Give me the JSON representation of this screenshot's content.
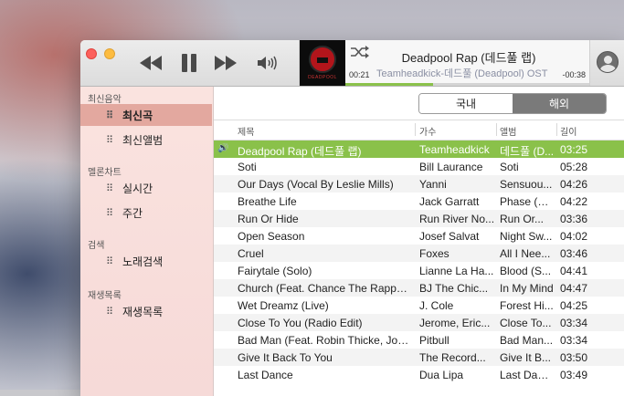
{
  "player": {
    "song_title": "Deadpool Rap (데드풀 랩)",
    "song_sub": "Teamheadkick-데드풀 (Deadpool) OST",
    "time_elapsed": "00:21",
    "time_remaining": "-00:38",
    "progress_fraction": 0.36,
    "album_art_caption": "DEADPOOL"
  },
  "sidebar": {
    "sections": [
      {
        "title": "최신음악",
        "items": [
          {
            "label": "최신곡",
            "active": true
          },
          {
            "label": "최신앨범",
            "active": false
          }
        ]
      },
      {
        "title": "멜론차트",
        "items": [
          {
            "label": "실시간",
            "active": false
          },
          {
            "label": "주간",
            "active": false
          }
        ]
      },
      {
        "title": "검색",
        "items": [
          {
            "label": "노래검색",
            "active": false
          }
        ]
      },
      {
        "title": "재생목록",
        "items": [
          {
            "label": "재생목록",
            "active": false
          }
        ]
      }
    ]
  },
  "segment": {
    "domestic": "국내",
    "foreign": "해외",
    "selected": "foreign"
  },
  "table": {
    "headers": {
      "title": "제목",
      "artist": "가수",
      "album": "앨범",
      "length": "길이"
    },
    "rows": [
      {
        "title": "Deadpool Rap (데드풀 랩)",
        "artist": "Teamheadkick",
        "album": "데드풀 (D...",
        "length": "03:25",
        "playing": true
      },
      {
        "title": "Soti",
        "artist": "Bill Laurance",
        "album": "Soti",
        "length": "05:28"
      },
      {
        "title": "Our Days (Vocal By Leslie Mills)",
        "artist": "Yanni",
        "album": "Sensuou...",
        "length": "04:26"
      },
      {
        "title": "Breathe Life",
        "artist": "Jack Garratt",
        "album": "Phase (D...",
        "length": "04:22"
      },
      {
        "title": "Run Or Hide",
        "artist": "Run River No...",
        "album": "Run Or...",
        "length": "03:36"
      },
      {
        "title": "Open Season",
        "artist": "Josef Salvat",
        "album": "Night Sw...",
        "length": "04:02"
      },
      {
        "title": "Cruel",
        "artist": "Foxes",
        "album": "All I Nee...",
        "length": "03:46"
      },
      {
        "title": "Fairytale (Solo)",
        "artist": "Lianne La Ha...",
        "album": "Blood (S...",
        "length": "04:41"
      },
      {
        "title": "Church (Feat. Chance The Rapper...",
        "artist": "BJ The Chic...",
        "album": "In My Mind",
        "length": "04:47"
      },
      {
        "title": "Wet Dreamz (Live)",
        "artist": "J. Cole",
        "album": "Forest Hi...",
        "length": "04:25"
      },
      {
        "title": "Close To You (Radio Edit)",
        "artist": "Jerome, Eric...",
        "album": "Close To...",
        "length": "03:34"
      },
      {
        "title": "Bad Man (Feat. Robin Thicke, Joe...",
        "artist": "Pitbull",
        "album": "Bad Man...",
        "length": "03:34"
      },
      {
        "title": "Give It Back To You",
        "artist": "The Record...",
        "album": "Give It B...",
        "length": "03:50"
      },
      {
        "title": "Last Dance",
        "artist": "Dua Lipa",
        "album": "Last Dance",
        "length": "03:49"
      }
    ]
  },
  "icons": {
    "rewind": "rewind-icon",
    "pause": "pause-icon",
    "forward": "fast-forward-icon",
    "volume": "volume-icon",
    "shuffle": "shuffle-icon",
    "user": "user-icon",
    "grid": "grid-icon"
  },
  "colors": {
    "accent": "#8ac14a",
    "sidebar_active": "#e3a89f"
  }
}
